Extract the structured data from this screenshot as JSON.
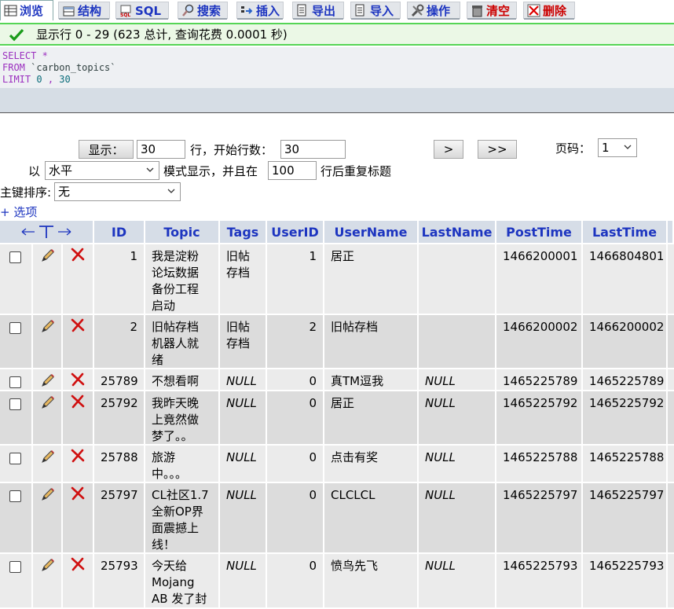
{
  "tabs": [
    {
      "id": "browse",
      "label": "浏览",
      "icon": "browse-icon",
      "active": true
    },
    {
      "id": "structure",
      "label": "结构",
      "icon": "structure-icon"
    },
    {
      "id": "sql",
      "label": "SQL",
      "icon": "sql-icon"
    },
    {
      "id": "search",
      "label": "搜索",
      "icon": "search-icon"
    },
    {
      "id": "insert",
      "label": "插入",
      "icon": "insert-icon"
    },
    {
      "id": "export",
      "label": "导出",
      "icon": "export-icon"
    },
    {
      "id": "import",
      "label": "导入",
      "icon": "import-icon"
    },
    {
      "id": "operations",
      "label": "操作",
      "icon": "operations-icon"
    },
    {
      "id": "empty",
      "label": "清空",
      "icon": "empty-icon"
    },
    {
      "id": "drop",
      "label": "删除",
      "icon": "drop-icon"
    }
  ],
  "status": {
    "message": "显示行 0 - 29 (623 总计, 查询花费 0.0001 秒)",
    "color": "#56d556"
  },
  "sql": {
    "select_kw": "SELECT",
    "star": "*",
    "from_kw": "FROM",
    "table": "`carbon_topics`",
    "limit_kw": "LIMIT",
    "limit_start": "0",
    "comma": ",",
    "limit_count": "30"
  },
  "nav": {
    "show_label": "显示：",
    "rows_value": "30",
    "rows_text": "行，开始行数：",
    "start_value": "30",
    "next_label": ">",
    "last_label": ">>",
    "page_label": "页码：",
    "page_value": "1",
    "by_label": "以",
    "mode_value": "水平",
    "mode_text": "模式显示，并且在",
    "repeat_value": "100",
    "repeat_text": "行后重复标题",
    "sort_label": "主键排序:",
    "sort_value": "无",
    "options_label": "+ 选项"
  },
  "table": {
    "columns": [
      "ID",
      "Topic",
      "Tags",
      "UserID",
      "UserName",
      "LastName",
      "PostTime",
      "LastTime"
    ],
    "rows": [
      {
        "ID": "1",
        "Topic": [
          "我是淀粉",
          "论坛数据",
          "备份工程",
          "启动"
        ],
        "Tags": [
          "旧帖",
          "存档"
        ],
        "UserID": "1",
        "UserName": "居正",
        "LastName": "",
        "PostTime": "1466200001",
        "LastTime": "1466804801"
      },
      {
        "ID": "2",
        "Topic": [
          "旧帖存档",
          "机器人就",
          "绪"
        ],
        "Tags": [
          "旧帖",
          "存档"
        ],
        "UserID": "2",
        "UserName": "旧帖存档",
        "LastName": "",
        "PostTime": "1466200002",
        "LastTime": "1466200002"
      },
      {
        "ID": "25789",
        "Topic": [
          "不想看啊"
        ],
        "Tags": [
          "NULL"
        ],
        "UserID": "0",
        "UserName": "真TM逗我",
        "LastName": "NULL",
        "PostTime": "1465225789",
        "LastTime": "1465225789"
      },
      {
        "ID": "25792",
        "Topic": [
          "我昨天晚",
          "上竟然做",
          "梦了。。"
        ],
        "Tags": [
          "NULL"
        ],
        "UserID": "0",
        "UserName": "居正",
        "LastName": "NULL",
        "PostTime": "1465225792",
        "LastTime": "1465225792"
      },
      {
        "ID": "25788",
        "Topic": [
          "旅游",
          "中。。。"
        ],
        "Tags": [
          "NULL"
        ],
        "UserID": "0",
        "UserName": "点击有奖",
        "LastName": "NULL",
        "PostTime": "1465225788",
        "LastTime": "1465225788"
      },
      {
        "ID": "25797",
        "Topic": [
          "CL社区1.7",
          "全新OP界",
          "面震撼上",
          "线！"
        ],
        "Tags": [
          "NULL"
        ],
        "UserID": "0",
        "UserName": "CLCLCL",
        "LastName": "NULL",
        "PostTime": "1465225797",
        "LastTime": "1465225797"
      },
      {
        "ID": "25793",
        "Topic": [
          "今天给",
          "Mojang",
          "AB 发了封"
        ],
        "Tags": [
          "NULL"
        ],
        "UserID": "0",
        "UserName": "愤鸟先飞",
        "LastName": "NULL",
        "PostTime": "1465225793",
        "LastTime": "1465225793"
      }
    ]
  },
  "colors": {
    "link": "#1d35c0",
    "header_bg": "#d6dde7",
    "sql_keyword": "#9b2fbf",
    "danger": "#cc0000"
  }
}
